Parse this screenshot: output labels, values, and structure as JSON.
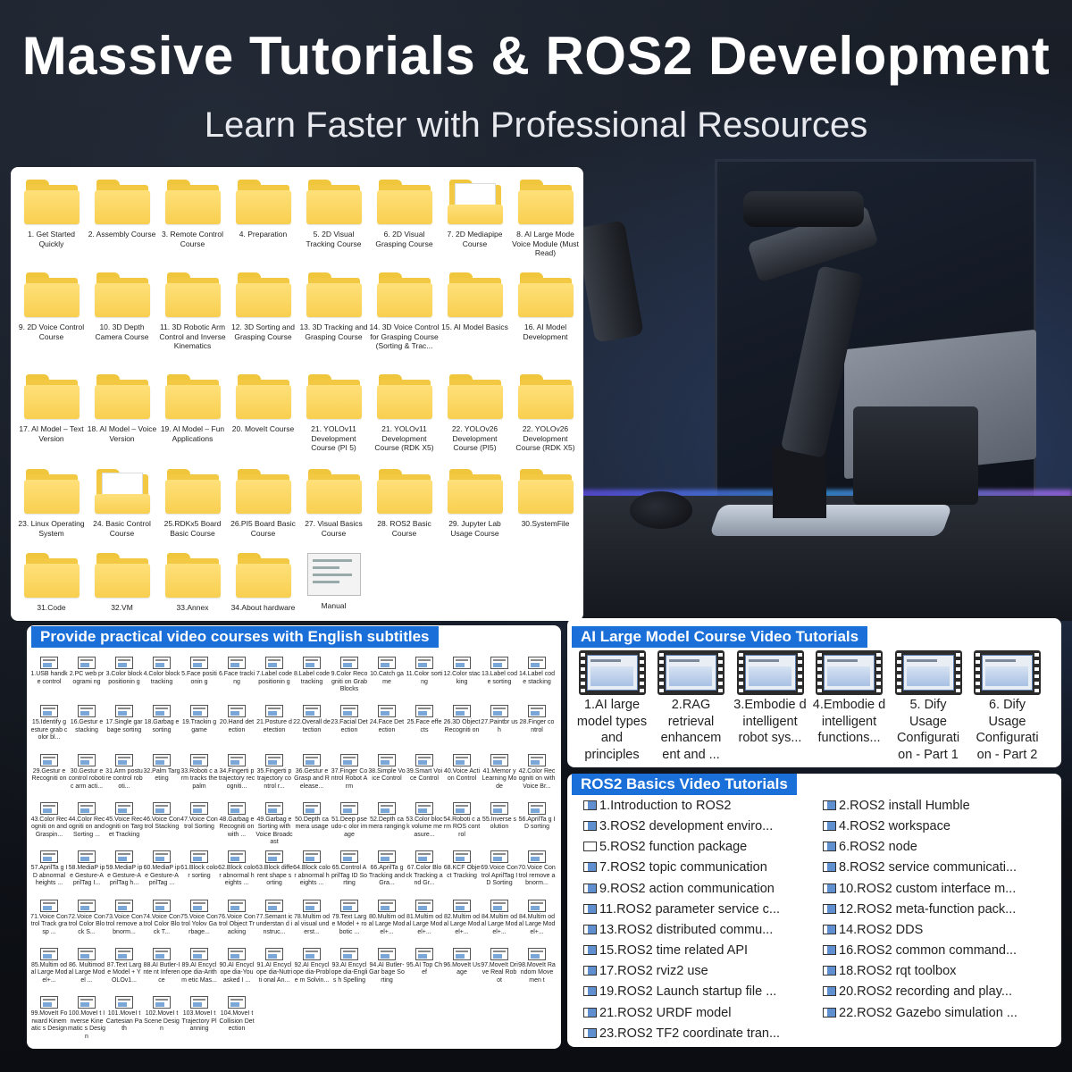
{
  "header": {
    "title": "Massive Tutorials & ROS2 Development",
    "subtitle": "Learn Faster with Professional Resources"
  },
  "explorer": {
    "folders": [
      {
        "label": "1. Get Started Quickly",
        "icon": "folder-icon"
      },
      {
        "label": "2. Assembly Course",
        "icon": "folder-icon"
      },
      {
        "label": "3. Remote Control Course",
        "icon": "folder-icon"
      },
      {
        "label": "4. Preparation",
        "icon": "folder-icon"
      },
      {
        "label": "5. 2D Visual Tracking Course",
        "icon": "folder-icon"
      },
      {
        "label": "6. 2D Visual Grasping Course",
        "icon": "folder-icon"
      },
      {
        "label": "7. 2D Mediapipe Course",
        "icon": "folder-with-files-icon"
      },
      {
        "label": "8. AI Large Mode Voice Module (Must Read)",
        "icon": "folder-icon"
      },
      {
        "label": "9. 2D Voice Control Course",
        "icon": "folder-icon"
      },
      {
        "label": "10. 3D Depth Camera Course",
        "icon": "folder-icon"
      },
      {
        "label": "11. 3D Robotic Arm Control and Inverse Kinematics",
        "icon": "folder-icon"
      },
      {
        "label": "12. 3D Sorting and Grasping Course",
        "icon": "folder-icon"
      },
      {
        "label": "13. 3D Tracking and Grasping Course",
        "icon": "folder-icon"
      },
      {
        "label": "14. 3D Voice Control for Grasping Course (Sorting & Trac...",
        "icon": "folder-icon"
      },
      {
        "label": "15. AI Model Basics",
        "icon": "folder-icon"
      },
      {
        "label": "16. AI Model Development",
        "icon": "folder-icon"
      },
      {
        "label": "17. AI Model – Text Version",
        "icon": "folder-icon"
      },
      {
        "label": "18. AI Model – Voice Version",
        "icon": "folder-icon"
      },
      {
        "label": "19. AI Model – Fun Applications",
        "icon": "folder-icon"
      },
      {
        "label": "20. MoveIt Course",
        "icon": "folder-icon"
      },
      {
        "label": "21. YOLOv11 Development Course (PI 5)",
        "icon": "folder-icon"
      },
      {
        "label": "21. YOLOv11 Development Course (RDK X5)",
        "icon": "folder-icon"
      },
      {
        "label": "22. YOLOv26 Development Course (PI5)",
        "icon": "folder-icon"
      },
      {
        "label": "22. YOLOv26 Development Course (RDK X5)",
        "icon": "folder-icon"
      },
      {
        "label": "23. Linux Operating System",
        "icon": "folder-icon"
      },
      {
        "label": "24. Basic Control Course",
        "icon": "folder-with-files-icon"
      },
      {
        "label": "25.RDKx5 Board Basic Course",
        "icon": "folder-icon"
      },
      {
        "label": "26.PI5 Board Basic Course",
        "icon": "folder-icon"
      },
      {
        "label": "27. Visual Basics Course",
        "icon": "folder-icon"
      },
      {
        "label": "28. ROS2 Basic Course",
        "icon": "folder-icon"
      },
      {
        "label": "29. Jupyter Lab Usage Course",
        "icon": "folder-icon"
      },
      {
        "label": "30.SystemFile",
        "icon": "folder-icon"
      },
      {
        "label": "31.Code",
        "icon": "folder-icon"
      },
      {
        "label": "32.VM",
        "icon": "folder-icon"
      },
      {
        "label": "33.Annex",
        "icon": "folder-icon"
      },
      {
        "label": "34.About hardware",
        "icon": "folder-icon"
      },
      {
        "label": "Manual",
        "icon": "document-icon"
      }
    ]
  },
  "video_courses": {
    "heading": "Provide practical video courses with English subtitles",
    "items": [
      "1.USB handke control",
      "2.PC web programi ng",
      "3.Color block positionin g",
      "4.Color block tracking",
      "5.Face positionin g",
      "6.Face tracking",
      "7.Label code positionin g",
      "8.Label code tracking",
      "9.Color Recogniti on Grab Blocks",
      "10.Catch game",
      "11.Color sorting",
      "12.Color stacking",
      "13.Label code sorting",
      "14.Label code stacking",
      "15.Identify gesture grab color bl...",
      "16.Gestur e stacking",
      "17.Single garbage sorting",
      "18.Garbag e sorting",
      "19.Trackin g game",
      "20.Hand detection",
      "21.Posture detection",
      "22.Overall detection",
      "23.Facial Detection",
      "24.Face Detection",
      "25.Face effects",
      "26.3D Object Recogniti on",
      "27.Paintbr ush",
      "28.Finger control",
      "29.Gestur e Recogniti on",
      "30.Gestur e control robotic arm acti...",
      "31.Arm posture control roboti...",
      "32.Palm Targeting",
      "33.Roboti c arm tracks the palm",
      "34.Fingerti p trajectory recogniti...",
      "35.Fingerti p trajectory control r...",
      "36.Gestur e Grasp and Release...",
      "37.Finger Control Robot Arm",
      "38.Simple Voice Control",
      "39.Smart Voice Control",
      "40.Voice Action Control",
      "41.Memor y Learning Mode",
      "42.Color Recogniti on with Voice Br...",
      "43.Color Recogniti on and Graspin...",
      "44.Color Recogniti on and Sorting ...",
      "45.Voice Recogniti on Target Tracking",
      "46.Voice Control Stacking",
      "47.Voice Control Sorting",
      "48.Garbag e Recogniti on with ...",
      "49.Garbag e Sorting with Voice Broadcast",
      "50.Depth camera usage",
      "51.Deep pseudo-c olor image",
      "52.Depth camera ranging",
      "53.Color block volume measure...",
      "54.Roboti c arm ROS control",
      "55.Inverse solution",
      "56.AprilTa g ID sorting",
      "57.AprilTa g ID abnormal heights ...",
      "58.MediaP ipe Gesture-A prilTag I...",
      "59.MediaP ipe Gesture-A prilTag h...",
      "60.MediaP ipe Gesture-A prilTag ...",
      "61.Block color sorting",
      "62.Block color abnormal heights ...",
      "63.Block different shape sorting",
      "64.Block color abnormal heights ...",
      "65.Control AprilTag ID Sorting",
      "66.AprilTa g Tracking and Gra...",
      "67.Color Block Tracking and Gr...",
      "68.KCF Object Tracking",
      "69.Voice Control AprilTag ID Sorting",
      "70.Voice Control remove abnorm...",
      "71.Voice Control Track grasp ...",
      "72.Voice Control Color Block S...",
      "73.Voice Control remove abnorm...",
      "74.Voice Control Color Block T...",
      "75.Voice Control Yolov Garbage...",
      "76.Voice Control Object Tracking",
      "77.Semant ic understan d instruc...",
      "78.Multim odal visual underst...",
      "79.Text Large Model + robotic ...",
      "80.Multim odal Large Model+...",
      "81.Multim odal Large Model+...",
      "82.Multim odal Large Model+...",
      "84.Multim odal Large Model+...",
      "84.Multim odal Large Model+...",
      "85.Multim odal Large Model+...",
      "86. Multimod al Large Model ...",
      "87.Text Large Model + YOLOv1...",
      "88.AI Butler-Inte nt Inference",
      "89.AI Encyclope dia-Arithm etic Mas...",
      "90.AI Encyclope dia-You asked I ...",
      "91.AI Encyclope dia-Nutriti onal An...",
      "92.AI Encyclope dia-Proble m Solvin...",
      "93.AI Encyclope dia-Englis h Spelling",
      "94.AI Butler-Gar bage Sorting",
      "95.AI Top Chef",
      "96.MoveIt Usage",
      "97.MoveIt Drive Real Robot",
      "98.MoveIt Random Movemen t",
      "99.MoveIt Forward Kinematic s Design",
      "100.MoveI t Inverse Kinematic s Design",
      "101.MoveI t Cartesian Path",
      "102.MoveI t Scene Design",
      "103.MoveI t Trajectory Planning",
      "104.MoveI t Collision Detection"
    ]
  },
  "ai_course": {
    "heading": "AI Large Model Course Video Tutorials",
    "items": [
      "1.AI large model types and principles",
      "2.RAG retrieval enhancem ent and ...",
      "3.Embodie d intelligent robot sys...",
      "4.Embodie d intelligent functions...",
      "5. Dify Usage Configurati on - Part 1",
      "6. Dify Usage Configurati on - Part 2"
    ]
  },
  "ros_course": {
    "heading": "ROS2 Basics Video Tutorials",
    "items": [
      "1.Introduction to ROS2",
      "2.ROS2 install Humble",
      "3.ROS2 development enviro...",
      "4.ROS2 workspace",
      "5.ROS2 function package",
      "6.ROS2 node",
      "7.ROS2 topic communication",
      "8.ROS2 service communicati...",
      "9.ROS2 action communication",
      "10.ROS2 custom interface m...",
      "11.ROS2 parameter service c...",
      "12.ROS2 meta-function pack...",
      "13.ROS2 distributed commu...",
      "14.ROS2 DDS",
      "15.ROS2 time related API",
      "16.ROS2 common command...",
      "17.ROS2 rviz2 use",
      "18.ROS2 rqt toolbox",
      "19.ROS2 Launch startup file ...",
      "20.ROS2 recording and play...",
      "21.ROS2 URDF model",
      "22.ROS2 Gazebo simulation ...",
      "23.ROS2 TF2 coordinate tran..."
    ]
  },
  "colors": {
    "accent": "#1a6fd8",
    "folder": "#f8cf4f",
    "background": "#11151c"
  }
}
